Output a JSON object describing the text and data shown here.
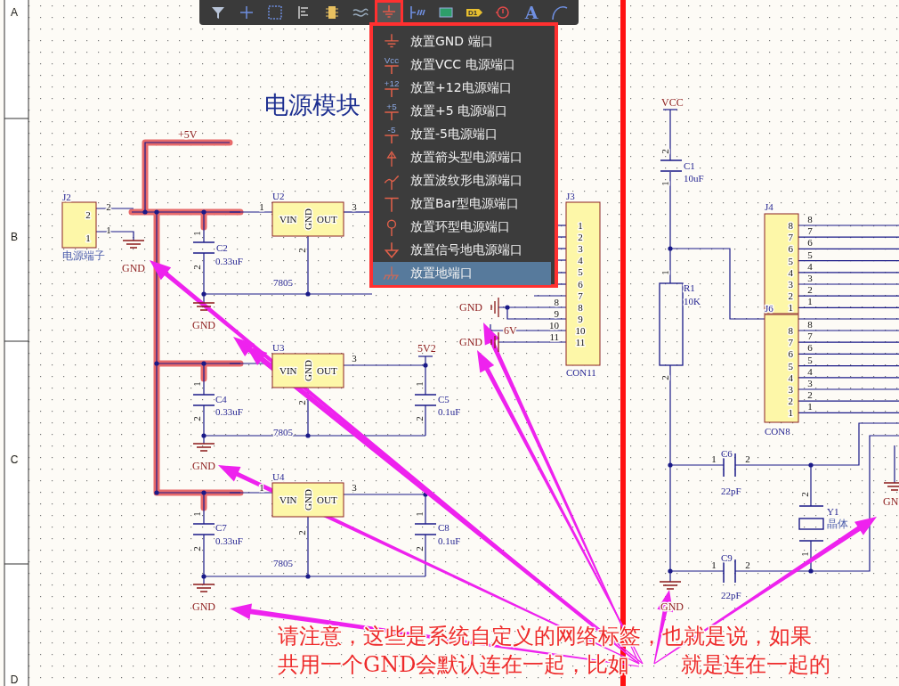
{
  "toolbar": {
    "tools": [
      {
        "kind": "filter",
        "selected": false
      },
      {
        "kind": "crosshair",
        "selected": false
      },
      {
        "kind": "select",
        "selected": false
      },
      {
        "kind": "align",
        "selected": false
      },
      {
        "kind": "component",
        "selected": false
      },
      {
        "kind": "harness",
        "selected": false
      },
      {
        "kind": "ground",
        "selected": true
      },
      {
        "kind": "bus",
        "selected": false
      },
      {
        "kind": "part",
        "selected": false
      },
      {
        "kind": "netlabel",
        "glyph": "D1",
        "selected": false
      },
      {
        "kind": "probe",
        "selected": false
      },
      {
        "kind": "text",
        "glyph": "A",
        "selected": false
      },
      {
        "kind": "arc",
        "selected": false
      }
    ]
  },
  "menu": {
    "items": [
      {
        "label": "放置GND 端口",
        "kind": "gnd",
        "selected": false
      },
      {
        "label": "放置VCC 电源端口",
        "kind": "vcc",
        "icon_text": "Vcc",
        "selected": false
      },
      {
        "label": "放置+12电源端口",
        "kind": "vcc",
        "icon_text": "+12",
        "selected": false
      },
      {
        "label": "放置+5 电源端口",
        "kind": "vcc",
        "icon_text": "+5",
        "selected": false
      },
      {
        "label": "放置-5电源端口",
        "kind": "vcc",
        "icon_text": "-5",
        "selected": false
      },
      {
        "label": "放置箭头型电源端口",
        "kind": "arrow",
        "selected": false
      },
      {
        "label": "放置波纹形电源端口",
        "kind": "wave",
        "selected": false
      },
      {
        "label": "放置Bar型电源端口",
        "kind": "bar",
        "selected": false
      },
      {
        "label": "放置环型电源端口",
        "kind": "circle",
        "selected": false
      },
      {
        "label": "放置信号地电源端口",
        "kind": "signal",
        "selected": false
      },
      {
        "label": "放置地端口",
        "kind": "earth",
        "selected": true
      }
    ]
  },
  "sheet": {
    "labels": [
      {
        "text": "A",
        "kind": "zone"
      },
      {
        "text": "B",
        "kind": "zone"
      },
      {
        "text": "C",
        "kind": "zone"
      },
      {
        "text": "D",
        "kind": "zone"
      },
      {
        "text": "电源模块",
        "kind": "title"
      },
      {
        "text": "+5V",
        "kind": "power"
      },
      {
        "text": "J2",
        "kind": "designator"
      },
      {
        "text": "2",
        "kind": "pin"
      },
      {
        "text": "1",
        "kind": "pin"
      },
      {
        "text": "2",
        "kind": "pin"
      },
      {
        "text": "1",
        "kind": "pin"
      },
      {
        "text": "电源端子",
        "kind": "comment"
      },
      {
        "text": "GND",
        "kind": "power"
      },
      {
        "text": "U2",
        "kind": "designator"
      },
      {
        "text": "VIN",
        "kind": "pinname"
      },
      {
        "text": "GND",
        "kind": "pinname"
      },
      {
        "text": "OUT",
        "kind": "pinname"
      },
      {
        "text": "1",
        "kind": "pin"
      },
      {
        "text": "3",
        "kind": "pin"
      },
      {
        "text": "2",
        "kind": "pin"
      },
      {
        "text": "7805",
        "kind": "value"
      },
      {
        "text": "C2",
        "kind": "designator"
      },
      {
        "text": "0.33uF",
        "kind": "value"
      },
      {
        "text": "1",
        "kind": "pin"
      },
      {
        "text": "2",
        "kind": "pin"
      },
      {
        "text": "GND",
        "kind": "power"
      },
      {
        "text": "U3",
        "kind": "designator"
      },
      {
        "text": "VIN",
        "kind": "pinname"
      },
      {
        "text": "GND",
        "kind": "pinname"
      },
      {
        "text": "OUT",
        "kind": "pinname"
      },
      {
        "text": "3",
        "kind": "pin"
      },
      {
        "text": "2",
        "kind": "pin"
      },
      {
        "text": "7805",
        "kind": "value"
      },
      {
        "text": "5V2",
        "kind": "power"
      },
      {
        "text": "C4",
        "kind": "designator"
      },
      {
        "text": "0.33uF",
        "kind": "value"
      },
      {
        "text": "1",
        "kind": "pin"
      },
      {
        "text": "2",
        "kind": "pin"
      },
      {
        "text": "C5",
        "kind": "designator"
      },
      {
        "text": "0.1uF",
        "kind": "value"
      },
      {
        "text": "1",
        "kind": "pin"
      },
      {
        "text": "2",
        "kind": "pin"
      },
      {
        "text": "GND",
        "kind": "power"
      },
      {
        "text": "U4",
        "kind": "designator"
      },
      {
        "text": "VIN",
        "kind": "pinname"
      },
      {
        "text": "GND",
        "kind": "pinname"
      },
      {
        "text": "OUT",
        "kind": "pinname"
      },
      {
        "text": "1",
        "kind": "pin"
      },
      {
        "text": "3",
        "kind": "pin"
      },
      {
        "text": "2",
        "kind": "pin"
      },
      {
        "text": "7805",
        "kind": "value"
      },
      {
        "text": "C7",
        "kind": "designator"
      },
      {
        "text": "0.33uF",
        "kind": "value"
      },
      {
        "text": "1",
        "kind": "pin"
      },
      {
        "text": "2",
        "kind": "pin"
      },
      {
        "text": "C8",
        "kind": "designator"
      },
      {
        "text": "0.1uF",
        "kind": "value"
      },
      {
        "text": "1",
        "kind": "pin"
      },
      {
        "text": "2",
        "kind": "pin"
      },
      {
        "text": "GND",
        "kind": "power"
      },
      {
        "text": "J3",
        "kind": "designator"
      },
      {
        "text": "1",
        "kind": "pin"
      },
      {
        "text": "2",
        "kind": "pin"
      },
      {
        "text": "3",
        "kind": "pin"
      },
      {
        "text": "4",
        "kind": "pin"
      },
      {
        "text": "5",
        "kind": "pin"
      },
      {
        "text": "6",
        "kind": "pin"
      },
      {
        "text": "7",
        "kind": "pin"
      },
      {
        "text": "8",
        "kind": "pin"
      },
      {
        "text": "9",
        "kind": "pin"
      },
      {
        "text": "10",
        "kind": "pin"
      },
      {
        "text": "11",
        "kind": "pin"
      },
      {
        "text": "8",
        "kind": "pin"
      },
      {
        "text": "9",
        "kind": "pin"
      },
      {
        "text": "10",
        "kind": "pin"
      },
      {
        "text": "11",
        "kind": "pin"
      },
      {
        "text": "CON11",
        "kind": "designator"
      },
      {
        "text": "GND",
        "kind": "power"
      },
      {
        "text": "GND",
        "kind": "power"
      },
      {
        "text": "6V",
        "kind": "power"
      },
      {
        "text": "VCC",
        "kind": "power"
      },
      {
        "text": "C1",
        "kind": "designator"
      },
      {
        "text": "10uF",
        "kind": "value"
      },
      {
        "text": "2",
        "kind": "pin"
      },
      {
        "text": "1",
        "kind": "pin"
      },
      {
        "text": "R1",
        "kind": "designator"
      },
      {
        "text": "10K",
        "kind": "value"
      },
      {
        "text": "1",
        "kind": "pin"
      },
      {
        "text": "2",
        "kind": "pin"
      },
      {
        "text": "J4",
        "kind": "designator"
      },
      {
        "text": "8",
        "kind": "pin"
      },
      {
        "text": "7",
        "kind": "pin"
      },
      {
        "text": "6",
        "kind": "pin"
      },
      {
        "text": "5",
        "kind": "pin"
      },
      {
        "text": "4",
        "kind": "pin"
      },
      {
        "text": "3",
        "kind": "pin"
      },
      {
        "text": "2",
        "kind": "pin"
      },
      {
        "text": "1",
        "kind": "pin"
      },
      {
        "text": "8",
        "kind": "pin"
      },
      {
        "text": "7",
        "kind": "pin"
      },
      {
        "text": "6",
        "kind": "pin"
      },
      {
        "text": "5",
        "kind": "pin"
      },
      {
        "text": "4",
        "kind": "pin"
      },
      {
        "text": "3",
        "kind": "pin"
      },
      {
        "text": "2",
        "kind": "pin"
      },
      {
        "text": "1",
        "kind": "pin"
      },
      {
        "text": "J6",
        "kind": "designator"
      },
      {
        "text": "8",
        "kind": "pin"
      },
      {
        "text": "7",
        "kind": "pin"
      },
      {
        "text": "6",
        "kind": "pin"
      },
      {
        "text": "5",
        "kind": "pin"
      },
      {
        "text": "4",
        "kind": "pin"
      },
      {
        "text": "3",
        "kind": "pin"
      },
      {
        "text": "2",
        "kind": "pin"
      },
      {
        "text": "1",
        "kind": "pin"
      },
      {
        "text": "8",
        "kind": "pin"
      },
      {
        "text": "7",
        "kind": "pin"
      },
      {
        "text": "6",
        "kind": "pin"
      },
      {
        "text": "5",
        "kind": "pin"
      },
      {
        "text": "4",
        "kind": "pin"
      },
      {
        "text": "3",
        "kind": "pin"
      },
      {
        "text": "2",
        "kind": "pin"
      },
      {
        "text": "1",
        "kind": "pin"
      },
      {
        "text": "CON8",
        "kind": "designator"
      },
      {
        "text": "C6",
        "kind": "designator"
      },
      {
        "text": "22pF",
        "kind": "value"
      },
      {
        "text": "1",
        "kind": "pin"
      },
      {
        "text": "2",
        "kind": "pin"
      },
      {
        "text": "Y1",
        "kind": "designator"
      },
      {
        "text": "晶体",
        "kind": "comment"
      },
      {
        "text": "2",
        "kind": "pin"
      },
      {
        "text": "1",
        "kind": "pin"
      },
      {
        "text": "C9",
        "kind": "designator"
      },
      {
        "text": "22pF",
        "kind": "value"
      },
      {
        "text": "1",
        "kind": "pin"
      },
      {
        "text": "2",
        "kind": "pin"
      },
      {
        "text": "GND",
        "kind": "power"
      },
      {
        "text": "GN",
        "kind": "power"
      },
      {
        "text": "请注意，这些是系统自定义的网络标签，也就是说，如果",
        "kind": "note"
      },
      {
        "text": "共用一个GND会默认连在一起，比如",
        "kind": "note"
      },
      {
        "text": "就是连在一起的",
        "kind": "note"
      }
    ]
  }
}
